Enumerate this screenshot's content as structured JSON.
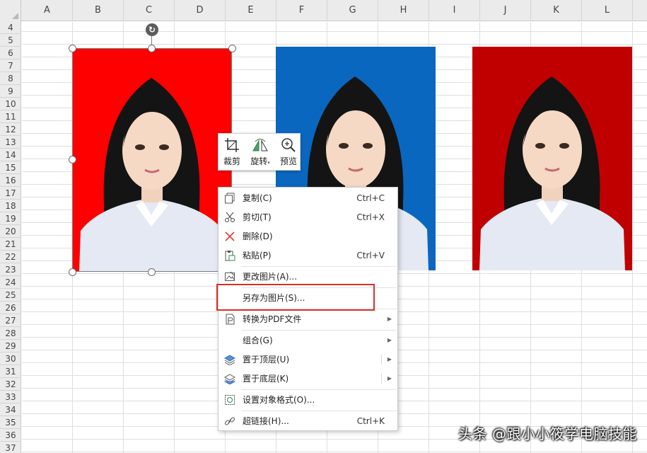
{
  "columns": [
    "A",
    "B",
    "C",
    "D",
    "E",
    "F",
    "G",
    "H",
    "I",
    "J",
    "K",
    "L"
  ],
  "rows": [
    "4",
    "5",
    "6",
    "7",
    "8",
    "9",
    "10",
    "11",
    "12",
    "13",
    "14",
    "15",
    "16",
    "17",
    "18",
    "19",
    "20",
    "21",
    "22",
    "23",
    "24",
    "25",
    "26",
    "27",
    "28",
    "29",
    "30",
    "31",
    "32",
    "33",
    "34",
    "35",
    "36",
    "37"
  ],
  "photos": [
    {
      "background": "#ff0000"
    },
    {
      "background": "#0a67c0"
    },
    {
      "background": "#c00000"
    }
  ],
  "mini_toolbar": {
    "crop": {
      "label": "裁剪",
      "icon": "crop-icon"
    },
    "rotate": {
      "label": "旋转",
      "icon": "rotate-icon"
    },
    "preview": {
      "label": "预览",
      "icon": "zoom-icon"
    }
  },
  "context_menu": {
    "items": [
      {
        "label": "复制(C)",
        "shortcut": "Ctrl+C",
        "icon": "copy-icon"
      },
      {
        "label": "剪切(T)",
        "shortcut": "Ctrl+X",
        "icon": "scissors-icon"
      },
      {
        "label": "删除(D)",
        "shortcut": "",
        "icon": "delete-icon"
      },
      {
        "label": "粘贴(P)",
        "shortcut": "Ctrl+V",
        "icon": "paste-icon"
      },
      {
        "label": "更改图片(A)...",
        "shortcut": "",
        "icon": "change-picture-icon"
      },
      {
        "label": "另存为图片(S)...",
        "shortcut": "",
        "icon": ""
      },
      {
        "label": "转换为PDF文件",
        "shortcut": "",
        "icon": "pdf-convert-icon"
      },
      {
        "label": "组合(G)",
        "shortcut": "",
        "icon": ""
      },
      {
        "label": "置于顶层(U)",
        "shortcut": "",
        "icon": "bring-to-front-icon"
      },
      {
        "label": "置于底层(K)",
        "shortcut": "",
        "icon": "send-to-back-icon"
      },
      {
        "label": "设置对象格式(O)...",
        "shortcut": "",
        "icon": "format-object-icon"
      },
      {
        "label": "超链接(H)...",
        "shortcut": "Ctrl+K",
        "icon": "hyperlink-icon"
      }
    ],
    "highlight_color": "#d9312b"
  },
  "watermark": "头条 @跟小小筱学电脑技能"
}
